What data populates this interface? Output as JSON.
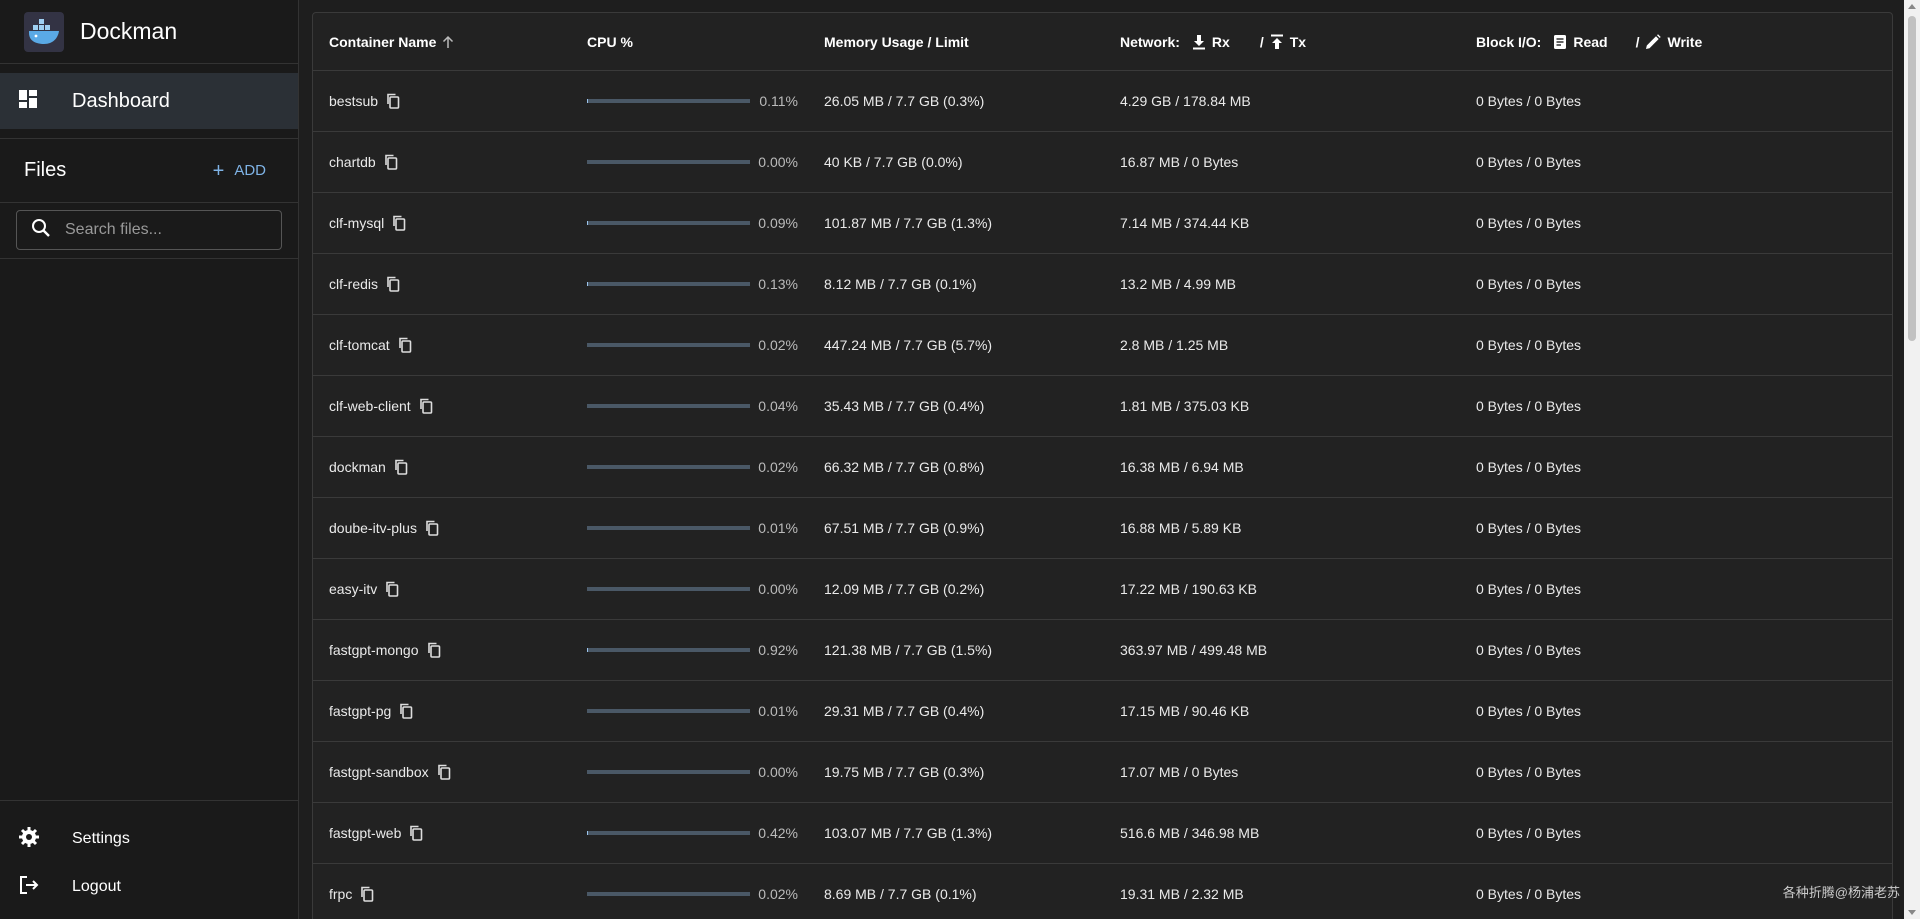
{
  "brand": {
    "title": "Dockman"
  },
  "nav": {
    "dashboard": "Dashboard"
  },
  "files": {
    "title": "Files",
    "add_label": "ADD",
    "search_placeholder": "Search files..."
  },
  "footer": {
    "settings": "Settings",
    "logout": "Logout"
  },
  "table": {
    "headers": {
      "name": "Container Name",
      "cpu": "CPU %",
      "memory": "Memory Usage / Limit",
      "network": "Network:",
      "rx": "Rx",
      "tx": "Tx",
      "block": "Block I/O:",
      "read": "Read",
      "write": "Write",
      "slash": "/"
    },
    "rows": [
      {
        "name": "bestsub",
        "cpu_pct": 0.11,
        "cpu": "0.11%",
        "mem": "26.05 MB / 7.7 GB (0.3%)",
        "net": "4.29 GB / 178.84 MB",
        "block": "0 Bytes / 0 Bytes"
      },
      {
        "name": "chartdb",
        "cpu_pct": 0.0,
        "cpu": "0.00%",
        "mem": "40 KB / 7.7 GB (0.0%)",
        "net": "16.87 MB / 0 Bytes",
        "block": "0 Bytes / 0 Bytes"
      },
      {
        "name": "clf-mysql",
        "cpu_pct": 0.09,
        "cpu": "0.09%",
        "mem": "101.87 MB / 7.7 GB (1.3%)",
        "net": "7.14 MB / 374.44 KB",
        "block": "0 Bytes / 0 Bytes"
      },
      {
        "name": "clf-redis",
        "cpu_pct": 0.13,
        "cpu": "0.13%",
        "mem": "8.12 MB / 7.7 GB (0.1%)",
        "net": "13.2 MB / 4.99 MB",
        "block": "0 Bytes / 0 Bytes"
      },
      {
        "name": "clf-tomcat",
        "cpu_pct": 0.02,
        "cpu": "0.02%",
        "mem": "447.24 MB / 7.7 GB (5.7%)",
        "net": "2.8 MB / 1.25 MB",
        "block": "0 Bytes / 0 Bytes"
      },
      {
        "name": "clf-web-client",
        "cpu_pct": 0.04,
        "cpu": "0.04%",
        "mem": "35.43 MB / 7.7 GB (0.4%)",
        "net": "1.81 MB / 375.03 KB",
        "block": "0 Bytes / 0 Bytes"
      },
      {
        "name": "dockman",
        "cpu_pct": 0.02,
        "cpu": "0.02%",
        "mem": "66.32 MB / 7.7 GB (0.8%)",
        "net": "16.38 MB / 6.94 MB",
        "block": "0 Bytes / 0 Bytes"
      },
      {
        "name": "doube-itv-plus",
        "cpu_pct": 0.01,
        "cpu": "0.01%",
        "mem": "67.51 MB / 7.7 GB (0.9%)",
        "net": "16.88 MB / 5.89 KB",
        "block": "0 Bytes / 0 Bytes"
      },
      {
        "name": "easy-itv",
        "cpu_pct": 0.0,
        "cpu": "0.00%",
        "mem": "12.09 MB / 7.7 GB (0.2%)",
        "net": "17.22 MB / 190.63 KB",
        "block": "0 Bytes / 0 Bytes"
      },
      {
        "name": "fastgpt-mongo",
        "cpu_pct": 0.92,
        "cpu": "0.92%",
        "mem": "121.38 MB / 7.7 GB (1.5%)",
        "net": "363.97 MB / 499.48 MB",
        "block": "0 Bytes / 0 Bytes"
      },
      {
        "name": "fastgpt-pg",
        "cpu_pct": 0.01,
        "cpu": "0.01%",
        "mem": "29.31 MB / 7.7 GB (0.4%)",
        "net": "17.15 MB / 90.46 KB",
        "block": "0 Bytes / 0 Bytes"
      },
      {
        "name": "fastgpt-sandbox",
        "cpu_pct": 0.0,
        "cpu": "0.00%",
        "mem": "19.75 MB / 7.7 GB (0.3%)",
        "net": "17.07 MB / 0 Bytes",
        "block": "0 Bytes / 0 Bytes"
      },
      {
        "name": "fastgpt-web",
        "cpu_pct": 0.42,
        "cpu": "0.42%",
        "mem": "103.07 MB / 7.7 GB (1.3%)",
        "net": "516.6 MB / 346.98 MB",
        "block": "0 Bytes / 0 Bytes"
      },
      {
        "name": "frpc",
        "cpu_pct": 0.02,
        "cpu": "0.02%",
        "mem": "8.69 MB / 7.7 GB (0.1%)",
        "net": "19.31 MB / 2.32 MB",
        "block": "0 Bytes / 0 Bytes"
      }
    ]
  },
  "watermark": "各种折腾@杨浦老苏",
  "colors": {
    "accent": "#7fb3e6",
    "bar_track": "#4a5866",
    "bar_fill": "#9cc4ec"
  }
}
